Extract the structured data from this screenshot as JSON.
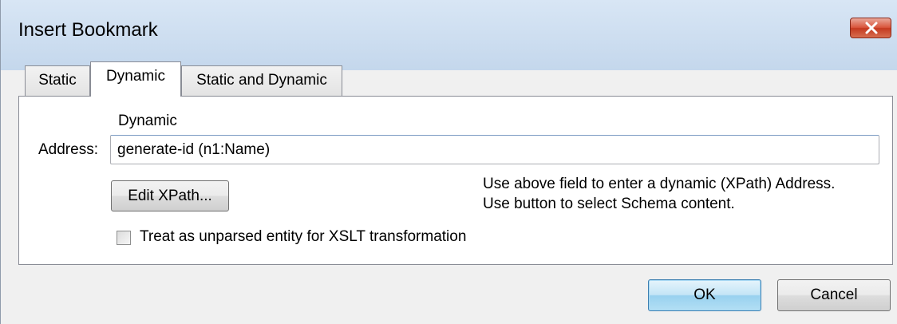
{
  "window": {
    "title": "Insert Bookmark"
  },
  "tabs": [
    {
      "label": "Static",
      "selected": false
    },
    {
      "label": "Dynamic",
      "selected": true
    },
    {
      "label": "Static and Dynamic",
      "selected": false
    }
  ],
  "dynamic": {
    "section_label": "Dynamic",
    "address_label": "Address:",
    "address_value": "generate-id (n1:Name)",
    "edit_xpath_label": "Edit XPath...",
    "hint_line1": "Use above field to enter a dynamic (XPath) Address.",
    "hint_line2": "Use button to select Schema content.",
    "checkbox_label": "Treat as unparsed entity for XSLT transformation",
    "checkbox_checked": false
  },
  "footer": {
    "ok_label": "OK",
    "cancel_label": "Cancel"
  },
  "icons": {
    "close": "close-icon"
  },
  "colors": {
    "titlebar": "#c4d7ec",
    "close_button": "#c4391f",
    "default_button": "#98d1ef"
  }
}
